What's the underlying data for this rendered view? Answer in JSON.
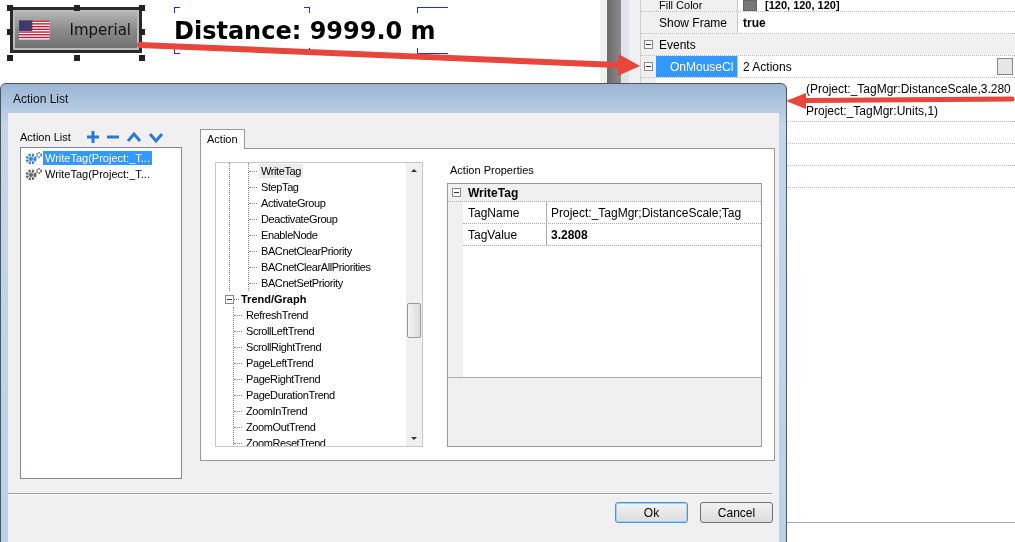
{
  "canvas": {
    "unit_button": {
      "label": "Imperial"
    },
    "distance_label": "Distance: 9999.0 m"
  },
  "properties": {
    "rows": [
      {
        "kind": "color",
        "name": "Fill Color",
        "value": "[120, 120, 120]",
        "color": "#787878",
        "selected": false
      },
      {
        "kind": "bold",
        "name": "Show Frame",
        "value": "true",
        "selected": false
      },
      {
        "kind": "category",
        "name": "Events",
        "expanded": true,
        "selected": false
      },
      {
        "kind": "event",
        "name": "OnMouseCl",
        "value": "2 Actions",
        "expanded": true,
        "selected": true
      },
      {
        "kind": "child",
        "value": "(Project:_TagMgr:DistanceScale,3.280"
      },
      {
        "kind": "child",
        "value": "Project:_TagMgr:Units,1)"
      },
      {
        "kind": "empty"
      },
      {
        "kind": "empty"
      },
      {
        "kind": "empty"
      }
    ]
  },
  "dialog": {
    "title": "Action List",
    "list_label": "Action List",
    "actions": [
      {
        "label": "WriteTag(Project:_T...",
        "selected": true
      },
      {
        "label": "WriteTag(Project:_T...",
        "selected": false
      }
    ],
    "tabs": [
      {
        "label": "Action",
        "selected": true
      }
    ],
    "tree": [
      {
        "children": [
          {
            "label": "WriteTag",
            "selected": true
          },
          {
            "label": "StepTag",
            "selected": false
          },
          {
            "label": "ActivateGroup",
            "selected": false
          },
          {
            "label": "DeactivateGroup",
            "selected": false
          },
          {
            "label": "EnableNode",
            "selected": false
          },
          {
            "label": "BACnetClearPriority",
            "selected": false
          },
          {
            "label": "BACnetClearAllPriorities",
            "selected": false
          },
          {
            "label": "BACnetSetPriority",
            "selected": false
          }
        ]
      },
      {
        "label": "Trend/Graph",
        "expanded": true,
        "children": [
          {
            "label": "RefreshTrend",
            "selected": false
          },
          {
            "label": "ScrollLeftTrend",
            "selected": false
          },
          {
            "label": "ScrollRightTrend",
            "selected": false
          },
          {
            "label": "PageLeftTrend",
            "selected": false
          },
          {
            "label": "PageRightTrend",
            "selected": false
          },
          {
            "label": "PageDurationTrend",
            "selected": false
          },
          {
            "label": "ZoomInTrend",
            "selected": false
          },
          {
            "label": "ZoomOutTrend",
            "selected": false
          },
          {
            "label": "ZoomResetTrend",
            "selected": false
          }
        ]
      }
    ],
    "properties_label": "Action Properties",
    "property_group": {
      "name": "WriteTag",
      "expanded": true,
      "rows": [
        {
          "name": "TagName",
          "value": "Project:_TagMgr;DistanceScale;Tag",
          "bold": false
        },
        {
          "name": "TagValue",
          "value": "3.2808",
          "bold": true
        }
      ]
    },
    "buttons": [
      {
        "label": "Ok",
        "default": true
      },
      {
        "label": "Cancel",
        "default": false
      }
    ]
  }
}
